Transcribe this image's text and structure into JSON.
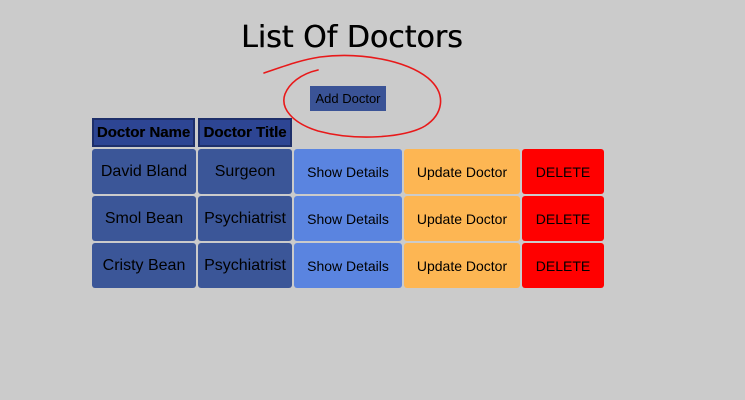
{
  "page": {
    "title": "List Of Doctors",
    "add_button_label": "Add Doctor"
  },
  "table": {
    "headers": [
      "Doctor Name",
      "Doctor Title"
    ],
    "rows": [
      {
        "name": "David Bland",
        "title": "Surgeon"
      },
      {
        "name": "Smol Bean",
        "title": "Psychiatrist"
      },
      {
        "name": "Cristy Bean",
        "title": "Psychiatrist"
      }
    ],
    "actions": {
      "show": "Show Details",
      "update": "Update Doctor",
      "delete": "DELETE"
    }
  },
  "colors": {
    "background": "#cbcbcb",
    "header": "#2d4593",
    "cell": "#3b5698",
    "show": "#5a84e0",
    "update": "#fdb653",
    "delete": "#ff0000",
    "annotation": "#e8191a"
  }
}
